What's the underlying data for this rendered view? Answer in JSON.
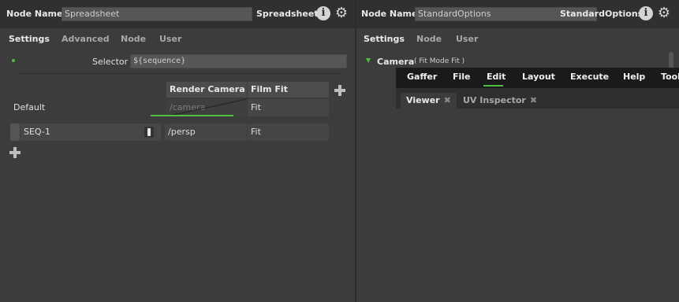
{
  "left": {
    "node_name_label": "Node Name",
    "node_name_value": "Spreadsheet",
    "node_type": "Spreadsheet",
    "tabs": [
      "Settings",
      "Advanced",
      "Node",
      "User"
    ],
    "selector_label": "Selector",
    "selector_value": "${sequence}",
    "columns": [
      "Render Camera",
      "Film Fit"
    ],
    "default_row": {
      "label": "Default",
      "camera": "/camera",
      "film_fit": "Fit"
    },
    "rows": [
      {
        "name": "SEQ-1",
        "camera": "/persp",
        "film_fit": "Fit"
      }
    ]
  },
  "right": {
    "node_name_label": "Node Name",
    "node_name_value": "StandardOptions",
    "node_type": "StandardOptions",
    "tabs": [
      "Settings",
      "Node",
      "User"
    ],
    "section_label": "Camera",
    "section_summary": "( Fit Mode Fit )"
  },
  "menu": [
    "Gaffer",
    "File",
    "Edit",
    "Layout",
    "Execute",
    "Help",
    "Tools"
  ],
  "viewer_tabs": [
    "Viewer",
    "UV Inspector"
  ],
  "colors": {
    "accent_green": "#4fbf3f",
    "panel": "#3c3c3c",
    "menu_bar": "#1a1a1a"
  }
}
